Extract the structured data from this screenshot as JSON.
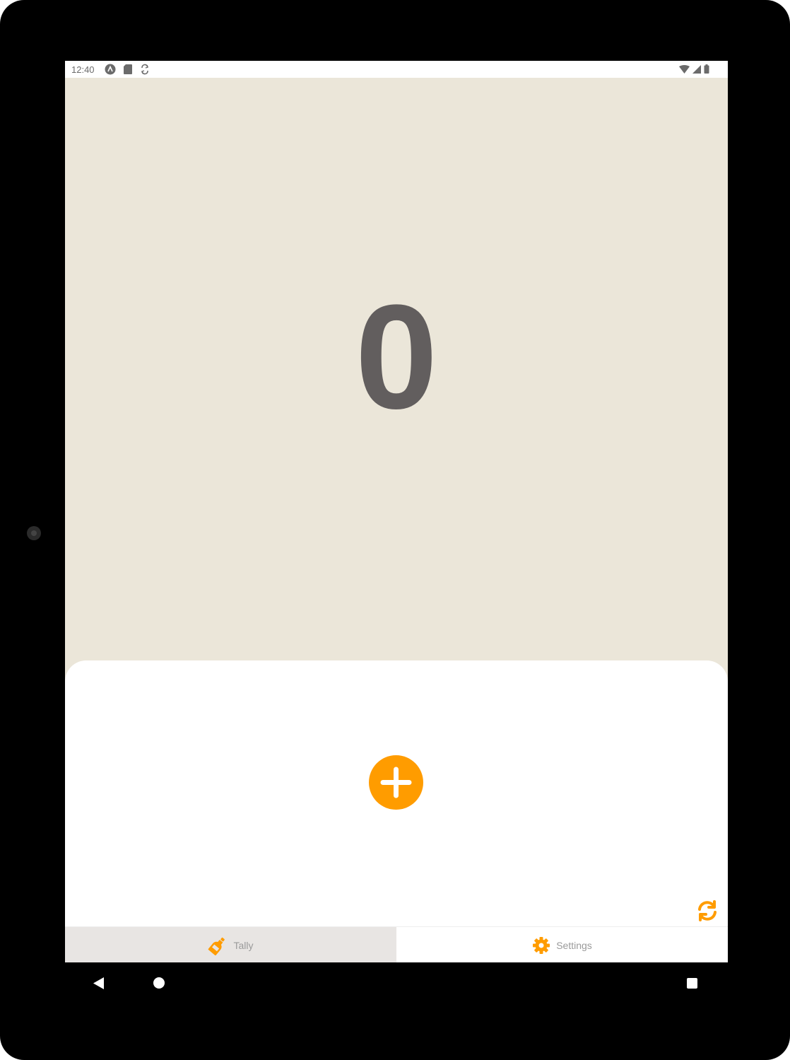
{
  "status_bar": {
    "time": "12:40",
    "left_icons": [
      "android-icon",
      "sd-card-icon",
      "sync-icon"
    ],
    "right_icons": [
      "wifi-icon",
      "signal-icon",
      "battery-icon"
    ]
  },
  "counter": {
    "value": "0"
  },
  "actions": {
    "increment_icon": "plus-circle-icon",
    "reset_icon": "refresh-icon"
  },
  "tabs": [
    {
      "label": "Tally",
      "icon": "bottle-icon",
      "active": true
    },
    {
      "label": "Settings",
      "icon": "gear-icon",
      "active": false
    }
  ],
  "nav_bar": {
    "icons": [
      "back-icon",
      "home-icon",
      "recents-icon"
    ]
  },
  "colors": {
    "accent": "#ff9c00",
    "background": "#ebe6d9",
    "counter_text": "#625e5e",
    "active_tab": "#e8e5e3"
  }
}
